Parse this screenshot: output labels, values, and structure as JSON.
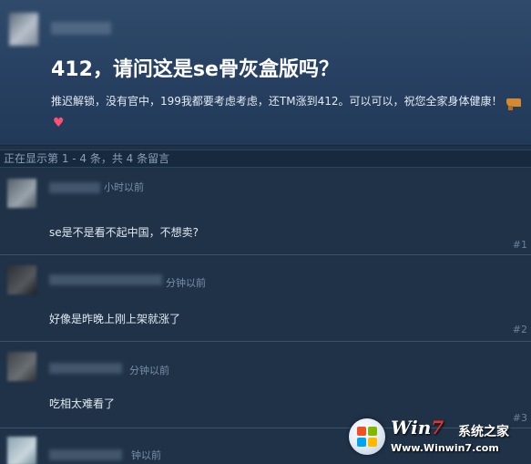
{
  "post": {
    "title": "412，请问这是se骨灰盒版吗？",
    "body": "推迟解锁，没有官中，199我都要考虑考虑，还TM涨到412。可以可以，祝您全家身体健康！",
    "icons": [
      "gun-icon",
      "heart-icon"
    ],
    "heart_glyph": "♥"
  },
  "comment_count_text": "正在显示第 1 - 4 条，共 4 条留言",
  "comments": [
    {
      "time": "小时以前",
      "text": "se是不是看不起中国，不想卖?",
      "index": "#1"
    },
    {
      "time": "分钟以前",
      "text": "好像是昨晚上刚上架就涨了",
      "index": "#2"
    },
    {
      "time": "分钟以前",
      "text": "吃相太难看了",
      "index": "#3"
    },
    {
      "time": "钟以前",
      "text": "",
      "index": ""
    }
  ],
  "watermark": {
    "brand_prefix": "Win",
    "brand_seven": "7",
    "cn": "系统之家",
    "url": "Www.Winwin7.com"
  },
  "colors": {
    "page_bg": "#1e3146",
    "post_bg": "#274061",
    "heart": "#ff4f73"
  }
}
